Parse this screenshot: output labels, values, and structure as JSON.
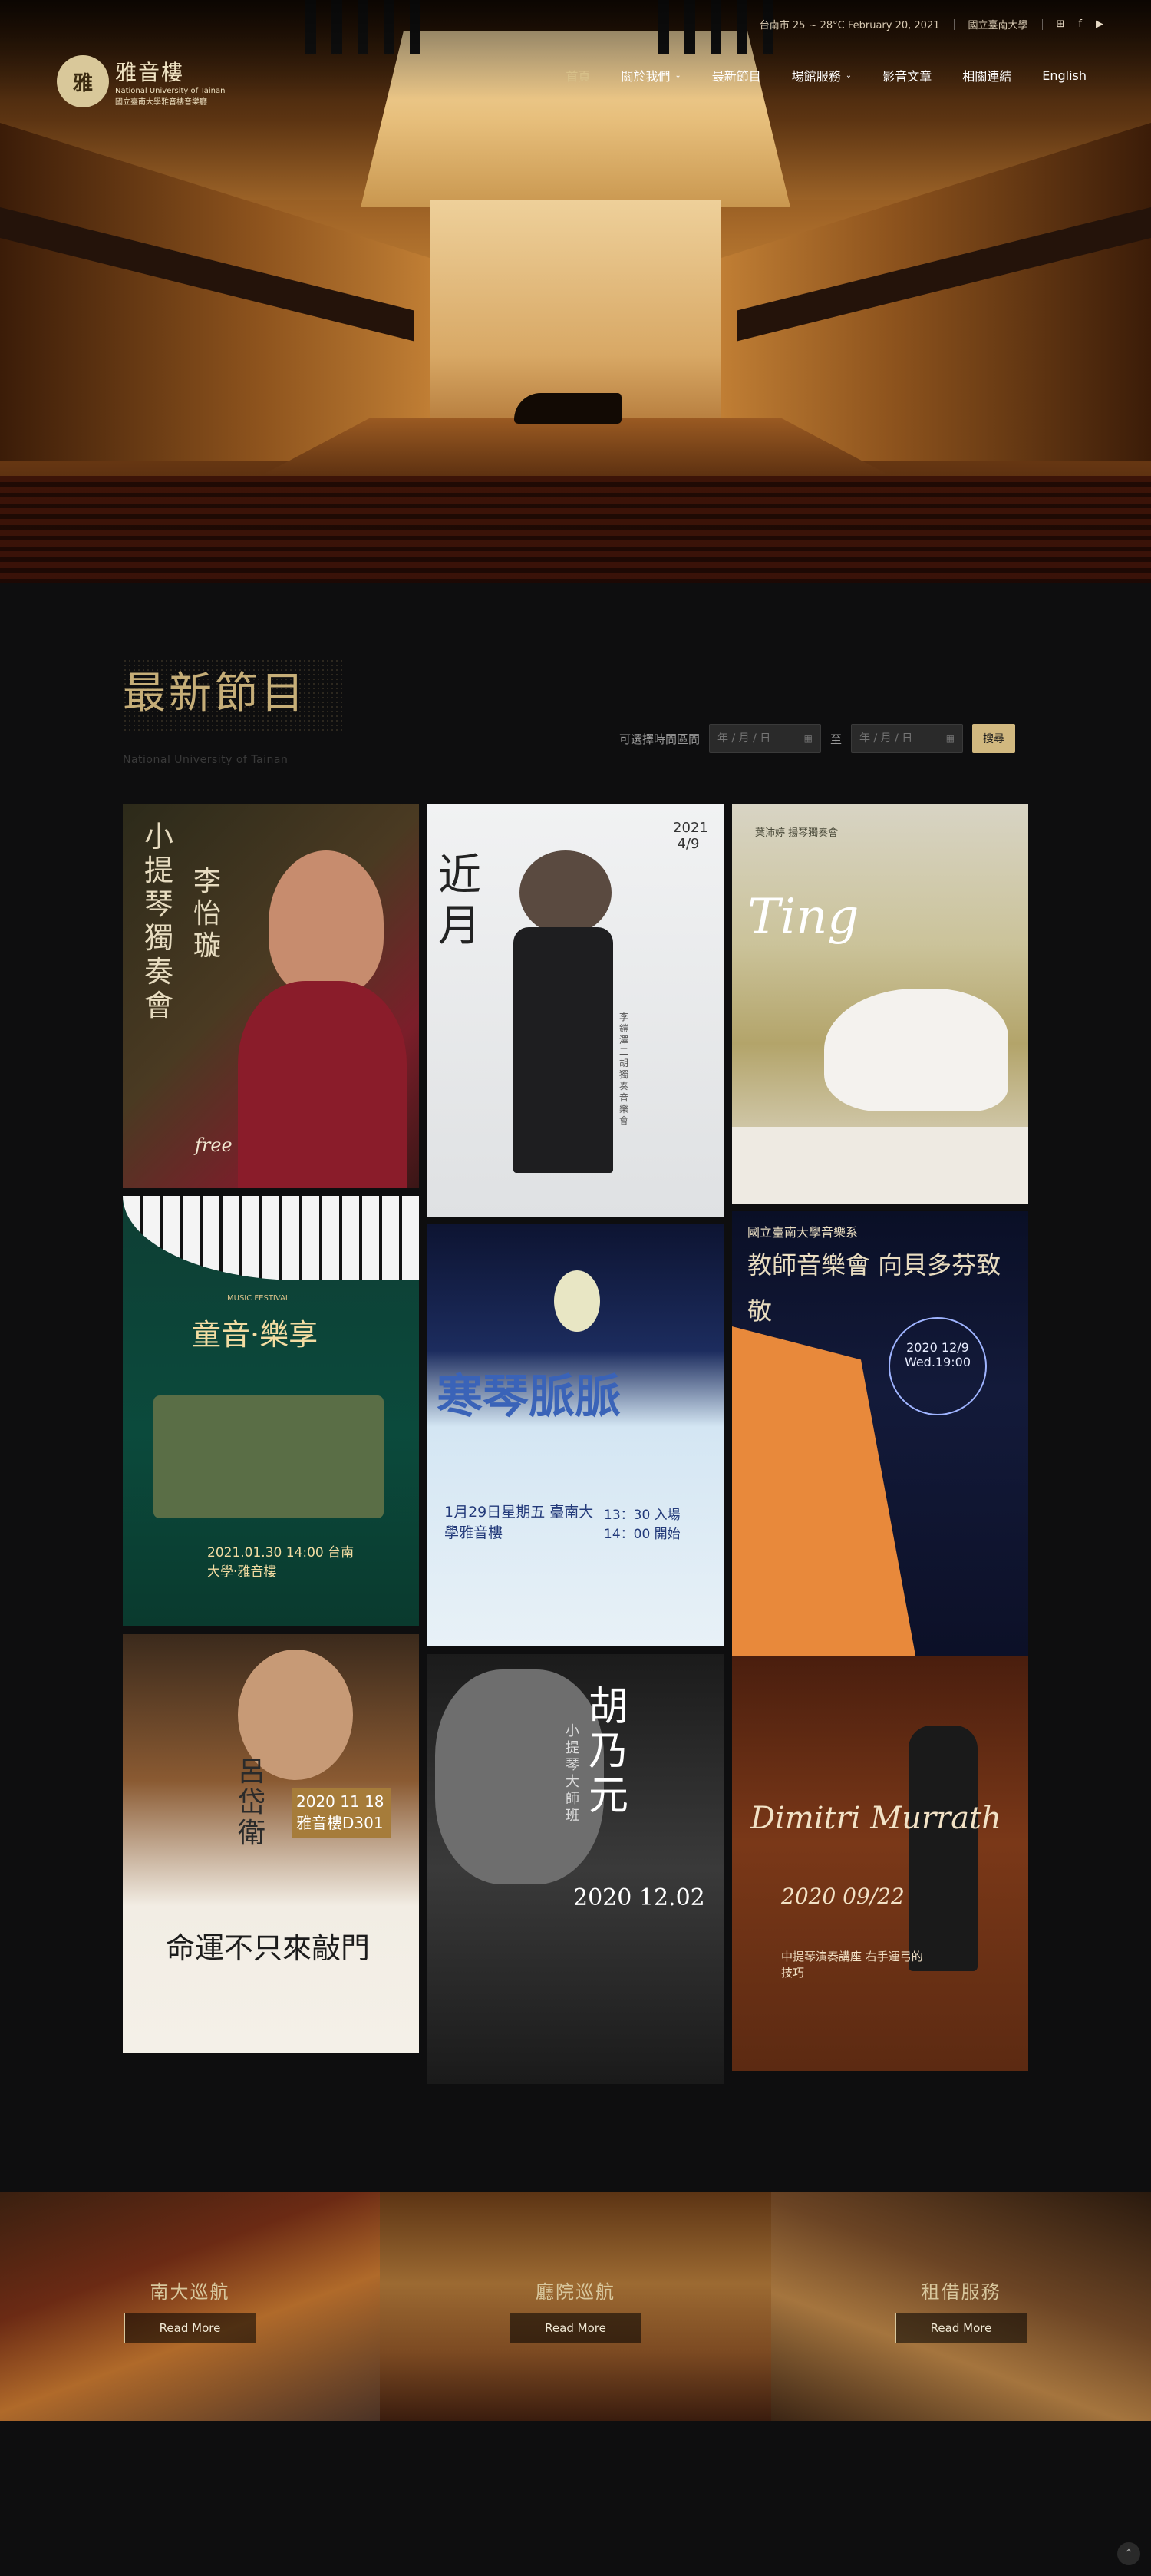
{
  "topbar": {
    "weather": "台南市 25 ~ 28°C  February 20, 2021",
    "university": "國立臺南大學",
    "icons": [
      "sitemap-icon",
      "facebook-icon",
      "youtube-icon"
    ]
  },
  "logo": {
    "seal_text": "雅",
    "name_cn": "雅音樓",
    "name_en": "National University of Tainan",
    "name_sub": "國立臺南大學雅音樓音樂廳"
  },
  "nav": {
    "items": [
      {
        "label": "首頁",
        "active": true,
        "dropdown": false
      },
      {
        "label": "關於我們",
        "active": false,
        "dropdown": true
      },
      {
        "label": "最新節目",
        "active": false,
        "dropdown": false
      },
      {
        "label": "場館服務",
        "active": false,
        "dropdown": true
      },
      {
        "label": "影音文章",
        "active": false,
        "dropdown": false
      },
      {
        "label": "相關連結",
        "active": false,
        "dropdown": false
      },
      {
        "label": "English",
        "active": false,
        "dropdown": false
      }
    ]
  },
  "programs": {
    "title": "最新節目",
    "subtitle": "National University of Tainan",
    "filter_label": "可選擇時間區間",
    "date_placeholder": "年 / 月 / 日",
    "to_label": "至",
    "search_label": "搜尋"
  },
  "posters": [
    {
      "title": "小提琴獨奏會",
      "name": "李怡璇",
      "extra": "free"
    },
    {
      "title": "近月",
      "name": "李鎧澤 二胡獨奏音樂會",
      "extra": "2021 4/9"
    },
    {
      "title": "Ting",
      "name": "葉沛婷 揚琴獨奏會",
      "extra": ""
    },
    {
      "title": "童音·樂享",
      "name": "2021.01.30 14:00 台南大學·雅音樓",
      "extra": "MUSIC FESTIVAL"
    },
    {
      "title": "寒琴脈脈",
      "name": "1月29日星期五 臺南大學雅音樓",
      "extra": "13：30 入場 14：00 開始"
    },
    {
      "title": "教師音樂會 向貝多芬致敬",
      "name": "國立臺南大學音樂系",
      "extra": "2020 12/9 Wed.19:00"
    },
    {
      "title": "命運不只來敲門",
      "name": "呂岱衛",
      "extra": "2020 11 18 雅音樓D301"
    },
    {
      "title": "胡乃元",
      "name": "小提琴大師班",
      "extra": "2020 12.02"
    },
    {
      "title": "Dimitri Murrath",
      "name": "中提琴演奏講座 右手運弓的技巧",
      "extra": "2020 09/22"
    }
  ],
  "features": [
    {
      "title": "南大巡航",
      "button": "Read More"
    },
    {
      "title": "廳院巡航",
      "button": "Read More"
    },
    {
      "title": "租借服務",
      "button": "Read More"
    }
  ],
  "colors": {
    "accent": "#d1b87f",
    "background": "#0e0e0f",
    "gold_text": "#c6ae78"
  }
}
